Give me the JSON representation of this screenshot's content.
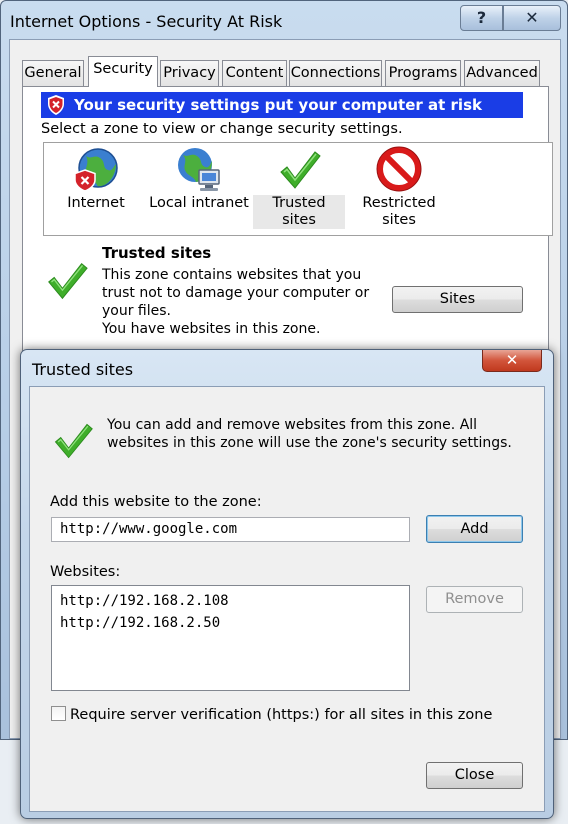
{
  "main_window": {
    "title": "Internet Options - Security At Risk",
    "help_button": "?",
    "close_button": "✕",
    "tabs": [
      "General",
      "Security",
      "Privacy",
      "Content",
      "Connections",
      "Programs",
      "Advanced"
    ],
    "active_tab": "Security",
    "warning_banner": "Your security settings put your computer at risk",
    "zone_prompt": "Select a zone to view or change security settings.",
    "zones": [
      {
        "label": "Internet",
        "icon": "globe-warning-icon"
      },
      {
        "label": "Local intranet",
        "icon": "intranet-globe-icon"
      },
      {
        "label": "Trusted sites",
        "icon": "checkmark-icon"
      },
      {
        "label": "Restricted sites",
        "icon": "restricted-icon"
      }
    ],
    "selected_zone": "Trusted sites",
    "detail": {
      "title": "Trusted sites",
      "description": "This zone contains websites that you trust not to damage your computer or your files.",
      "status": "You have websites in this zone."
    },
    "sites_button": "Sites"
  },
  "dialog": {
    "title": "Trusted sites",
    "close_button": "✕",
    "info": "You can add and remove websites from this zone. All websites in this zone will use the zone's security settings.",
    "add_label": "Add this website to the zone:",
    "url_value": "http://www.google.com",
    "add_button": "Add",
    "websites_label": "Websites:",
    "websites": [
      "http://192.168.2.108",
      "http://192.168.2.50"
    ],
    "remove_button": "Remove",
    "require_https_label": "Require server verification (https:) for all sites in this zone",
    "require_https_checked": false,
    "close_label": "Close"
  },
  "colors": {
    "warning_banner_bg": "#1a3de6",
    "check_green": "#3fae2a",
    "restricted_red": "#d91a1a"
  }
}
